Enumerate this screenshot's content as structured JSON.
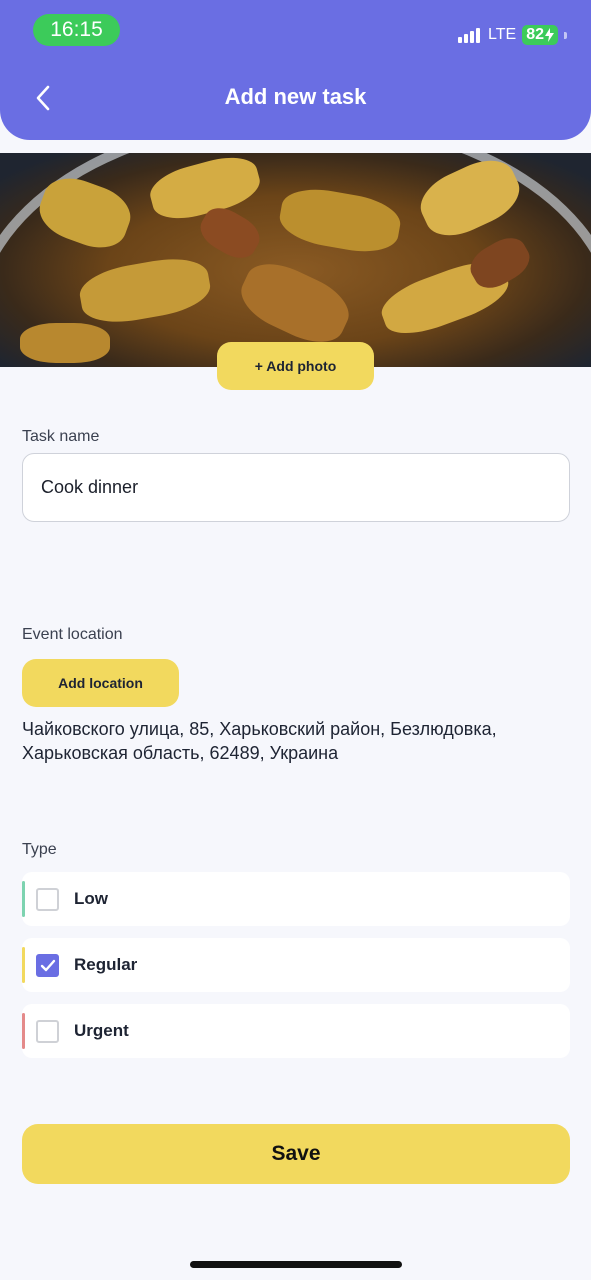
{
  "status_bar": {
    "time": "16:15",
    "network": "LTE",
    "battery": "82"
  },
  "header": {
    "title": "Add new task",
    "back_icon": "chevron-left-icon"
  },
  "photo": {
    "add_photo_label": "+ Add photo"
  },
  "task_name": {
    "label": "Task name",
    "value": "Cook dinner"
  },
  "location": {
    "label": "Event location",
    "button_label": "Add location",
    "address": "Чайковского улица, 85, Харьковский район, Безлюдовка, Харьковская область, 62489, Украина"
  },
  "type": {
    "label": "Type",
    "options": [
      {
        "label": "Low",
        "checked": false,
        "color": "#7dd3b0"
      },
      {
        "label": "Regular",
        "checked": true,
        "color": "#f2d95e"
      },
      {
        "label": "Urgent",
        "checked": false,
        "color": "#e48a8a"
      }
    ]
  },
  "save_label": "Save",
  "colors": {
    "accent": "#6a6ee3",
    "button": "#f2d95e",
    "status_green": "#3ccb5a"
  }
}
